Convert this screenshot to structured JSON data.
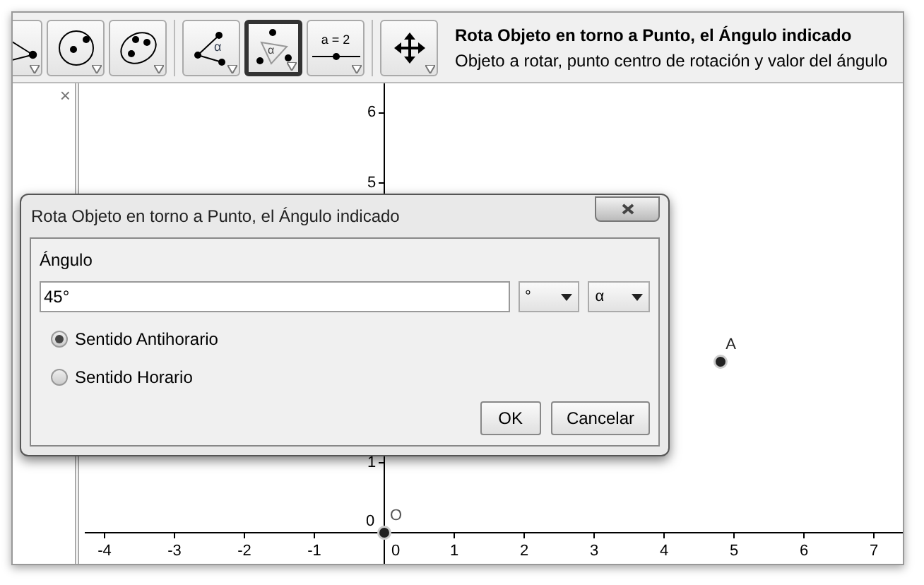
{
  "toolbar": {
    "tools": [
      {
        "kind": "segments",
        "selected": false
      },
      {
        "kind": "circle",
        "selected": false
      },
      {
        "kind": "conic",
        "selected": false
      },
      {
        "kind": "angle",
        "selected": false,
        "label": "α"
      },
      {
        "kind": "rotate",
        "selected": true,
        "label": "α"
      },
      {
        "kind": "slider",
        "selected": false,
        "label": "a = 2"
      },
      {
        "kind": "move",
        "selected": false
      }
    ],
    "help": {
      "title": "Rota Objeto en torno a Punto, el Ángulo indicado",
      "description": "Objeto a rotar, punto centro de rotación y valor del ángulo"
    }
  },
  "side_panel": {
    "close": "×"
  },
  "graphics": {
    "x_ticks": [
      "-4",
      "-3",
      "-2",
      "-1",
      "0",
      "1",
      "2",
      "3",
      "4",
      "5",
      "6",
      "7"
    ],
    "y_ticks": [
      "6",
      "5",
      "1"
    ],
    "origin_tick": "0",
    "points": [
      {
        "kind": "free",
        "name": "A"
      },
      {
        "kind": "origin",
        "name": "O"
      }
    ]
  },
  "dialog": {
    "title": "Rota Objeto en torno a Punto, el Ángulo indicado",
    "field_label": "Ángulo",
    "value": "45°",
    "dropdowns": [
      "°",
      "α"
    ],
    "options": [
      {
        "label": "Sentido Antihorario",
        "selected": true
      },
      {
        "label": "Sentido Horario",
        "selected": false
      }
    ],
    "buttons": [
      "OK",
      "Cancelar"
    ]
  }
}
